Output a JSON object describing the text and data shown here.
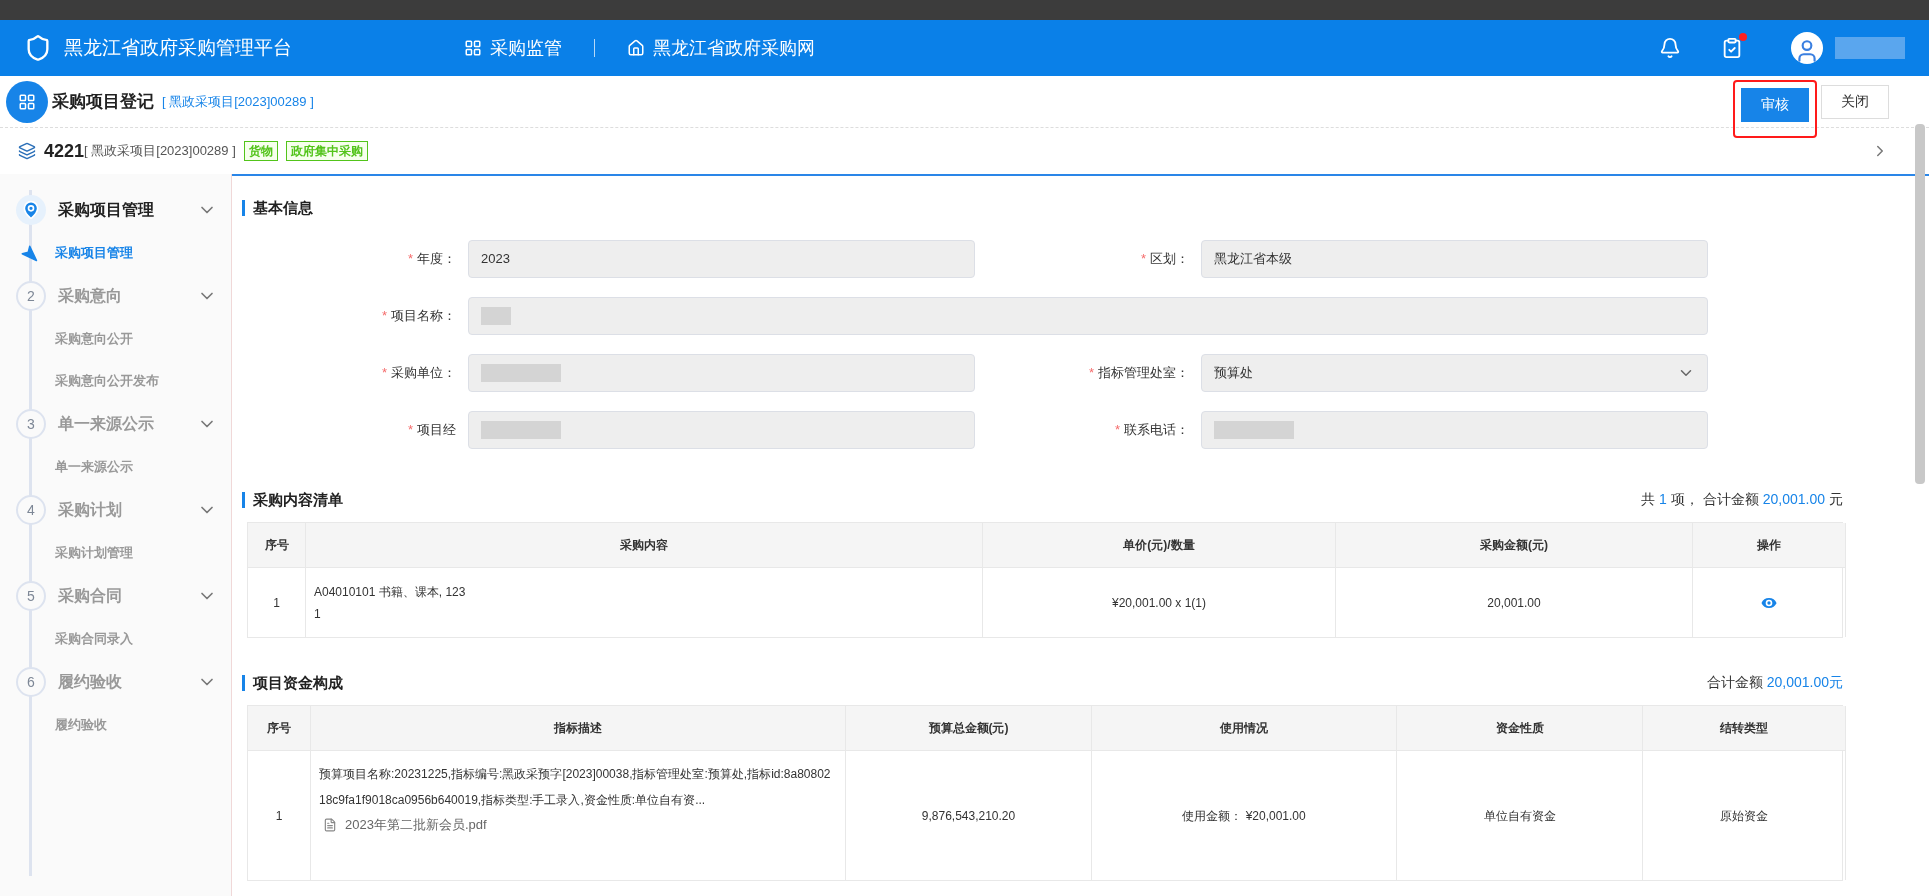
{
  "top_bar": {
    "title": "黑龙江省政府采购管理平台",
    "nav": [
      {
        "label": "采购监管",
        "kind": "apps"
      },
      {
        "label": "黑龙江省政府采购网",
        "kind": "home"
      }
    ],
    "task_alert": true
  },
  "page_header": {
    "title": "采购项目登记",
    "code": "[ 黑政采项目[2023]00289 ]",
    "buttons": [
      {
        "label": "审核",
        "kind": "primary",
        "highlighted": true
      },
      {
        "label": "关闭",
        "kind": "default",
        "highlighted": false
      }
    ]
  },
  "project_bar": {
    "id": "4221",
    "code": "[ 黑政采项目[2023]00289 ]",
    "tags": [
      "货物",
      "政府集中采购"
    ]
  },
  "sidebar": {
    "steps": [
      {
        "title": "采购项目管理",
        "selected": true,
        "expanded": true,
        "children": [
          {
            "label": "采购项目管理",
            "selected": true
          }
        ]
      },
      {
        "number": "2",
        "title": "采购意向",
        "selected": false,
        "expanded": true,
        "children": [
          {
            "label": "采购意向公开",
            "selected": false
          },
          {
            "label": "采购意向公开发布",
            "selected": false
          }
        ]
      },
      {
        "number": "3",
        "title": "单一来源公示",
        "selected": false,
        "expanded": true,
        "children": [
          {
            "label": "单一来源公示",
            "selected": false
          }
        ]
      },
      {
        "number": "4",
        "title": "采购计划",
        "selected": false,
        "expanded": true,
        "children": [
          {
            "label": "采购计划管理",
            "selected": false
          }
        ]
      },
      {
        "number": "5",
        "title": "采购合同",
        "selected": false,
        "expanded": true,
        "children": [
          {
            "label": "采购合同录入",
            "selected": false
          }
        ]
      },
      {
        "number": "6",
        "title": "履约验收",
        "selected": false,
        "expanded": true,
        "children": [
          {
            "label": "履约验收",
            "selected": false
          }
        ]
      }
    ]
  },
  "basic_info": {
    "title": "基本信息",
    "rows": [
      [
        {
          "mark": "*",
          "label": "年度：",
          "kind": "text",
          "value": "2023",
          "redacted": false
        },
        {
          "mark": "*",
          "label": "区划：",
          "kind": "text",
          "value": "黑龙江省本级",
          "redacted": false
        }
      ],
      [
        {
          "mark": "*",
          "label": "项目名称：",
          "kind": "text",
          "redacted": true
        }
      ],
      [
        {
          "mark": "*",
          "label": "采购单位：",
          "kind": "text",
          "redacted": true
        },
        {
          "mark": "*",
          "label": "指标管理处室：",
          "kind": "select",
          "value": "预算处",
          "redacted": false
        }
      ],
      [
        {
          "mark": "*",
          "label": "项目经",
          "kind": "text",
          "redacted": true
        },
        {
          "mark": "*",
          "label": "联系电话：",
          "kind": "text",
          "redacted": true
        }
      ]
    ]
  },
  "purchase_list": {
    "title": "采购内容清单",
    "summary": [
      {
        "text": "共",
        "highlight": false
      },
      {
        "text": "1",
        "highlight": true
      },
      {
        "text": "项，  合计金额",
        "highlight": false
      },
      {
        "text": "20,001.00",
        "highlight": true
      },
      {
        "text": "元",
        "highlight": false
      }
    ],
    "columns": [
      "序号",
      "采购内容",
      "单价(元)/数量",
      "采购金额(元)",
      "操作"
    ],
    "rows": [
      {
        "index": "1",
        "content": [
          "A04010101 书籍、课本, 123",
          "1"
        ],
        "price": "¥20,001.00 x 1(1)",
        "amount": "20,001.00"
      }
    ]
  },
  "funding": {
    "title": "项目资金构成",
    "summary": [
      {
        "text": "合计金额",
        "highlight": false
      },
      {
        "text": "20,001.00元",
        "highlight": true
      }
    ],
    "columns": [
      "序号",
      "指标描述",
      "预算总金额(元)",
      "使用情况",
      "资金性质",
      "结转类型"
    ],
    "rows": [
      {
        "index": "1",
        "description": "预算项目名称:20231225,指标编号:黑政采预字[2023]00038,指标管理处室:预算处,指标id:8a8080218c9fa1f9018ca0956b640019,指标类型:手工录入,资金性质:单位自有资...",
        "attachment": "2023年第二批新会员.pdf",
        "budget": "9,876,543,210.20",
        "usage": "使用金额：  ¥20,001.00",
        "fund_nature": "单位自有资金",
        "carryover": "原始资金"
      }
    ]
  }
}
